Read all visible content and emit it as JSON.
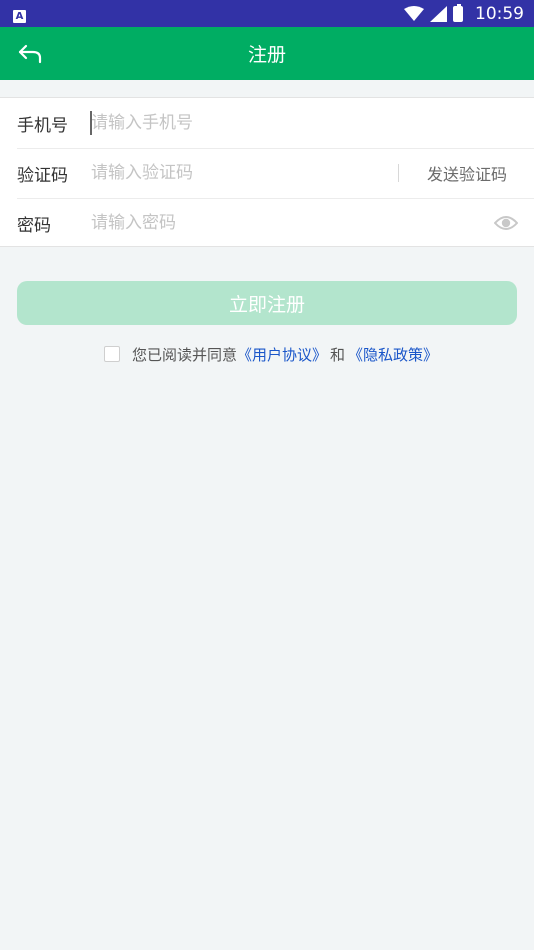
{
  "statusbar": {
    "app_icon_letter": "A",
    "time": "10:59"
  },
  "header": {
    "title": "注册"
  },
  "form": {
    "phone": {
      "label": "手机号",
      "placeholder": "请输入手机号"
    },
    "code": {
      "label": "验证码",
      "placeholder": "请输入验证码",
      "send_label": "发送验证码"
    },
    "password": {
      "label": "密码",
      "placeholder": "请输入密码"
    }
  },
  "submit": {
    "label": "立即注册"
  },
  "agreement": {
    "checked": false,
    "prefix": "您已阅读并同意",
    "user_agreement": "《用户协议》",
    "connector": "和",
    "privacy_policy": "《隐私政策》"
  },
  "colors": {
    "statusbar": "#3232a6",
    "primary": "#00ad63",
    "button_disabled": "#b3e5cd",
    "link": "#1a56c9",
    "background": "#f2f5f6"
  },
  "icons": [
    "back-arrow-icon",
    "wifi-icon",
    "signal-icon",
    "battery-icon",
    "eye-icon"
  ]
}
